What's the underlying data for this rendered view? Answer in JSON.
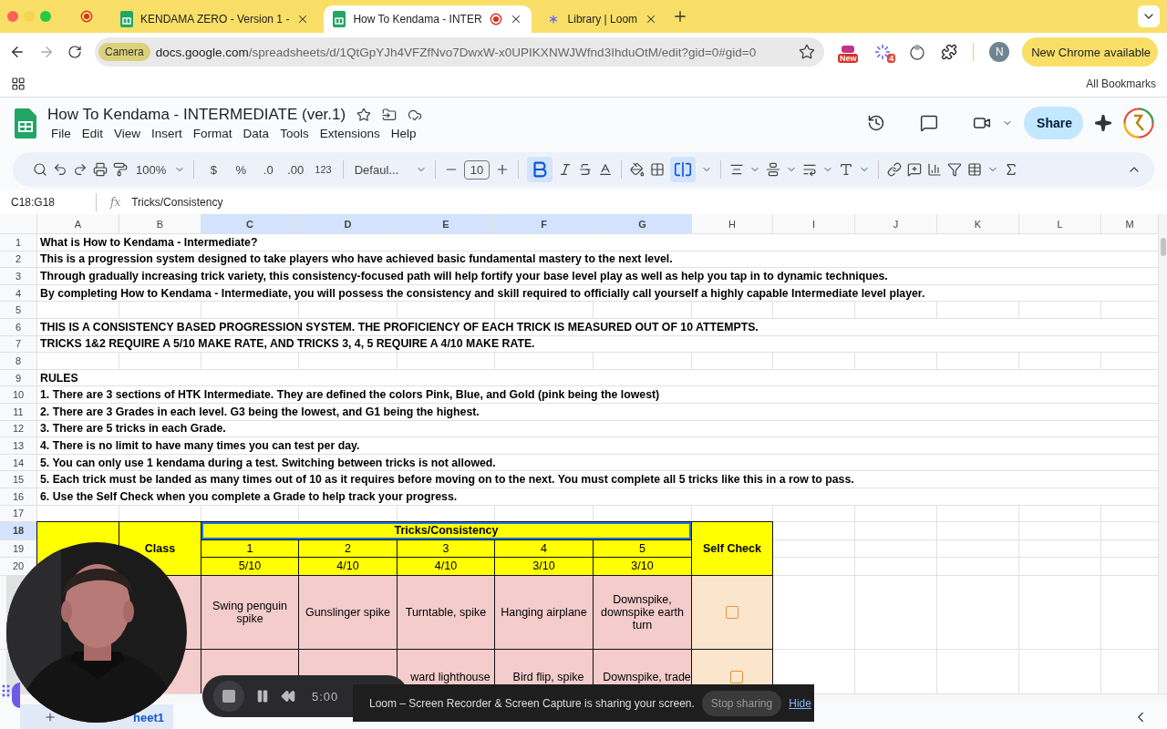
{
  "browser": {
    "tabs": [
      {
        "title": "KENDAMA ZERO - Version 1 -",
        "kind": "sheets",
        "selected": false,
        "recording": false
      },
      {
        "title": "How To Kendama - INTER",
        "kind": "sheets",
        "selected": true,
        "recording": true
      },
      {
        "title": "Library | Loom",
        "kind": "loom",
        "selected": false,
        "recording": false
      }
    ],
    "camera_chip": "Camera",
    "url_host": "docs.google.com",
    "url_path": "/spreadsheets/d/1QtGpYJh4VFZfNvo7DwxW-x0UPIKXNWJWfnd3IhduOtM/edit?gid=0#gid=0",
    "extension_badges": [
      "New",
      "4"
    ],
    "profile_initial": "N",
    "update_button": "New Chrome available",
    "bookmarks_folder": "All Bookmarks"
  },
  "sheet": {
    "title": "How To Kendama - INTERMEDIATE (ver.1)",
    "menu": [
      "File",
      "Edit",
      "View",
      "Insert",
      "Format",
      "Data",
      "Tools",
      "Extensions",
      "Help"
    ],
    "share": "Share",
    "toolbar": {
      "zoom": "100%",
      "currency": "$",
      "percent": "%",
      "decrease_decimals": ".0",
      "increase_decimals": ".00",
      "number_format": "123",
      "font": "Defaul...",
      "font_size": "10",
      "bold": true,
      "merge": true
    },
    "name_box": "C18:G18",
    "formula_icon": "fx",
    "formula": "Tricks/Consistency",
    "columns": [
      {
        "label": "A",
        "selected": false
      },
      {
        "label": "B",
        "selected": false
      },
      {
        "label": "C",
        "selected": true
      },
      {
        "label": "D",
        "selected": true
      },
      {
        "label": "E",
        "selected": true
      },
      {
        "label": "F",
        "selected": true
      },
      {
        "label": "G",
        "selected": true
      },
      {
        "label": "H",
        "selected": false
      },
      {
        "label": "I",
        "selected": false
      },
      {
        "label": "J",
        "selected": false
      },
      {
        "label": "K",
        "selected": false
      },
      {
        "label": "L",
        "selected": false
      },
      {
        "label": "M",
        "selected": false
      }
    ],
    "text_rows": [
      {
        "number": "1",
        "selected": false,
        "text": "What is How to Kendama - Intermediate?"
      },
      {
        "number": "2",
        "selected": false,
        "text": "This is a progression system designed to take players who have achieved basic fundamental mastery to the next level."
      },
      {
        "number": "3",
        "selected": false,
        "text": "Through gradually increasing trick variety, this consistency-focused path will help fortify your base level play as well as help you tap in to dynamic techniques."
      },
      {
        "number": "4",
        "selected": false,
        "text": "By completing How to Kendama - Intermediate, you will possess the consistency and skill required to officially call yourself a highly capable Intermediate level player."
      },
      {
        "number": "5",
        "selected": false
      },
      {
        "number": "6",
        "selected": false,
        "text": "THIS IS A CONSISTENCY BASED PROGRESSION SYSTEM. THE PROFICIENCY OF EACH TRICK IS MEASURED OUT OF 10 ATTEMPTS."
      },
      {
        "number": "7",
        "selected": false,
        "text": "TRICKS 1&2 REQUIRE A 5/10 MAKE RATE, AND TRICKS 3, 4, 5 REQUIRE A 4/10 MAKE RATE."
      },
      {
        "number": "8",
        "selected": false
      },
      {
        "number": "9",
        "selected": false,
        "text": "RULES"
      },
      {
        "number": "10",
        "selected": false,
        "text": "1. There are 3 sections of HTK Intermediate. They are defined the colors Pink, Blue, and Gold (pink being the lowest)"
      },
      {
        "number": "11",
        "selected": false,
        "text": "2. There are 3 Grades in each level. G3 being the lowest, and G1 being the highest."
      },
      {
        "number": "12",
        "selected": false,
        "text": "3. There are 5 tricks in each Grade."
      },
      {
        "number": "13",
        "selected": false,
        "text": "4. There is no limit to have many times you can test per day."
      },
      {
        "number": "14",
        "selected": false,
        "text": "5. You can only use 1 kendama during a test. Switching between tricks is not allowed."
      },
      {
        "number": "15",
        "selected": false,
        "text": "5. Each trick must be landed as many times out of 10 as it requires before moving on to the next. You must complete all 5 tricks like this in a row to pass."
      },
      {
        "number": "16",
        "selected": false,
        "text": "6. Use the Self Check when you complete a Grade to help track your progress."
      },
      {
        "number": "17",
        "selected": false
      }
    ],
    "table": {
      "row_numbers": [
        {
          "label": "18",
          "selected": true
        },
        {
          "label": "19",
          "selected": false
        },
        {
          "label": "20",
          "selected": false
        }
      ],
      "class_header": "Class",
      "tricks_header": "Tricks/Consistency",
      "tricks_header_selected": true,
      "self_check_header": "Self Check",
      "trick_numbers": [
        "1",
        "2",
        "3",
        "4",
        "5"
      ],
      "make_rates": [
        "5/10",
        "4/10",
        "4/10",
        "3/10",
        "3/10"
      ],
      "rows": [
        {
          "tricks": [
            "Swing penguin spike",
            "Gunslinger spike",
            "Turntable, spike",
            "Hanging airplane",
            "Downspike, downspike earth turn"
          ],
          "checked": false
        },
        {
          "tricks": [
            "ward lighthouse",
            "Bird flip, spike",
            "Downspike, trade"
          ],
          "checked": false
        }
      ]
    },
    "sheet_tab": "heet1"
  },
  "loom": {
    "timer": "5:00",
    "banner": "Loom – Screen Recorder & Screen Capture is sharing your screen.",
    "stop": "Stop sharing",
    "hide": "Hide"
  }
}
